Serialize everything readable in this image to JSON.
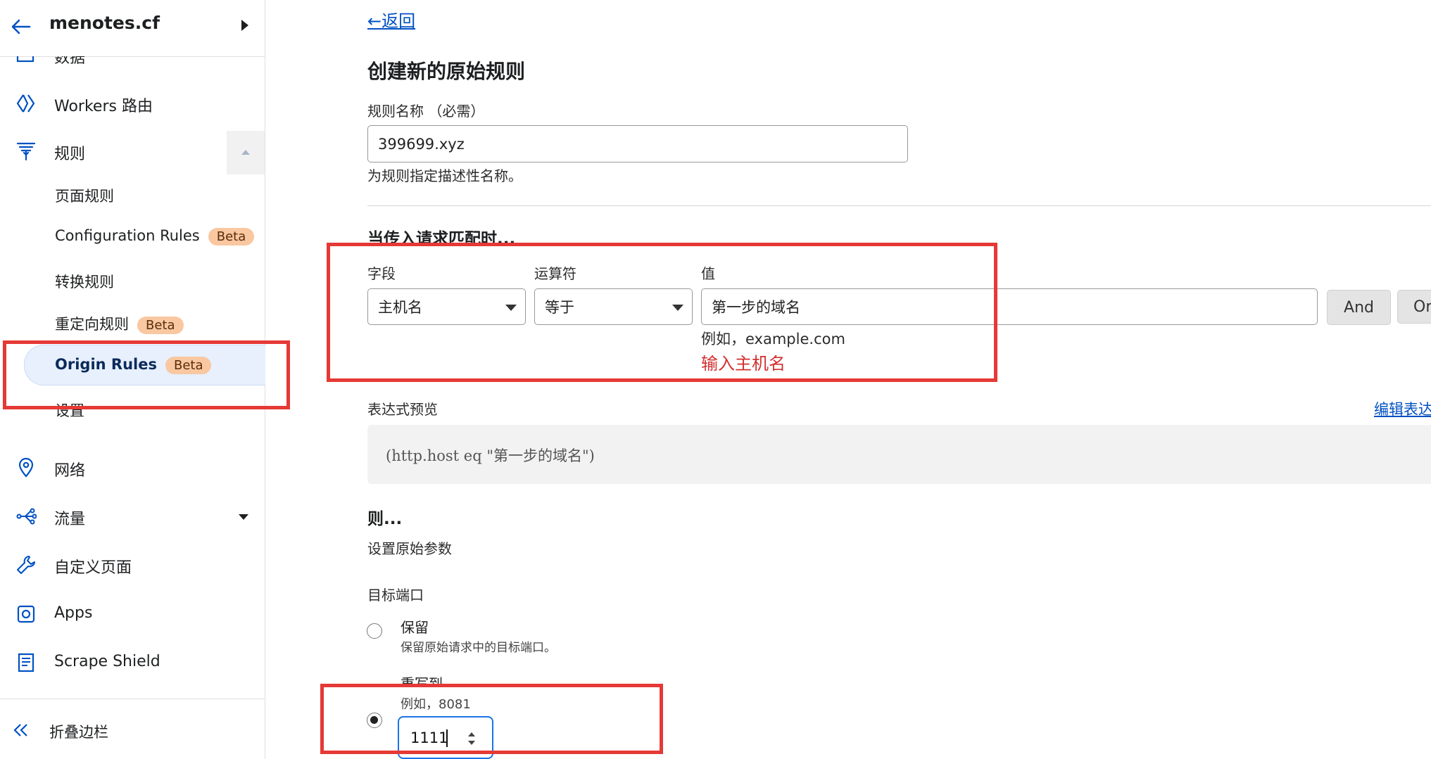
{
  "sidebar": {
    "domain": "menotes.cf",
    "top_partial_label": "数据",
    "items": [
      {
        "label": "Workers 路由",
        "icon": "workers-icon"
      },
      {
        "label": "规则",
        "icon": "rules-filter-icon"
      },
      {
        "label": "网络",
        "icon": "location-pin-icon"
      },
      {
        "label": "流量",
        "icon": "traffic-icon"
      },
      {
        "label": "自定义页面",
        "icon": "wrench-icon"
      },
      {
        "label": "Apps",
        "icon": "apps-icon"
      },
      {
        "label": "Scrape Shield",
        "icon": "document-icon"
      }
    ],
    "rules_sub": [
      {
        "label": "页面规则"
      },
      {
        "label": "Configuration Rules",
        "badge": "Beta"
      },
      {
        "label": "转换规则"
      },
      {
        "label": "重定向规则",
        "badge": "Beta"
      },
      {
        "label": "Origin Rules",
        "badge": "Beta"
      },
      {
        "label": "设置"
      }
    ],
    "collapse_label": "折叠边栏"
  },
  "main": {
    "back_link": "返回",
    "title": "创建新的原始规则",
    "rule_name": {
      "label": "规则名称 （必需）",
      "value": "399699.xyz",
      "help": "为规则指定描述性名称。"
    },
    "match": {
      "heading": "当传入请求匹配时...",
      "field_label": "字段",
      "operator_label": "运算符",
      "value_label": "值",
      "field_value": "主机名",
      "operator_value": "等于",
      "value_value": "第一步的域名",
      "value_hint": "例如，example.com",
      "annotation": "输入主机名",
      "and_button": "And",
      "or_button": "Or"
    },
    "expression": {
      "label": "表达式预览",
      "edit_link": "编辑表达式",
      "code": "(http.host eq \"第一步的域名\")"
    },
    "then": {
      "heading": "则...",
      "subheading": "设置原始参数",
      "port_label": "目标端口",
      "preserve_title": "保留",
      "preserve_desc": "保留原始请求中的目标端口。",
      "rewrite_title": "重写到",
      "rewrite_hint": "例如，8081",
      "rewrite_value": "1111"
    }
  },
  "colors": {
    "accent": "#0051c3",
    "annotation_red": "#e53935",
    "beta_badge": "#f9c7a0"
  }
}
